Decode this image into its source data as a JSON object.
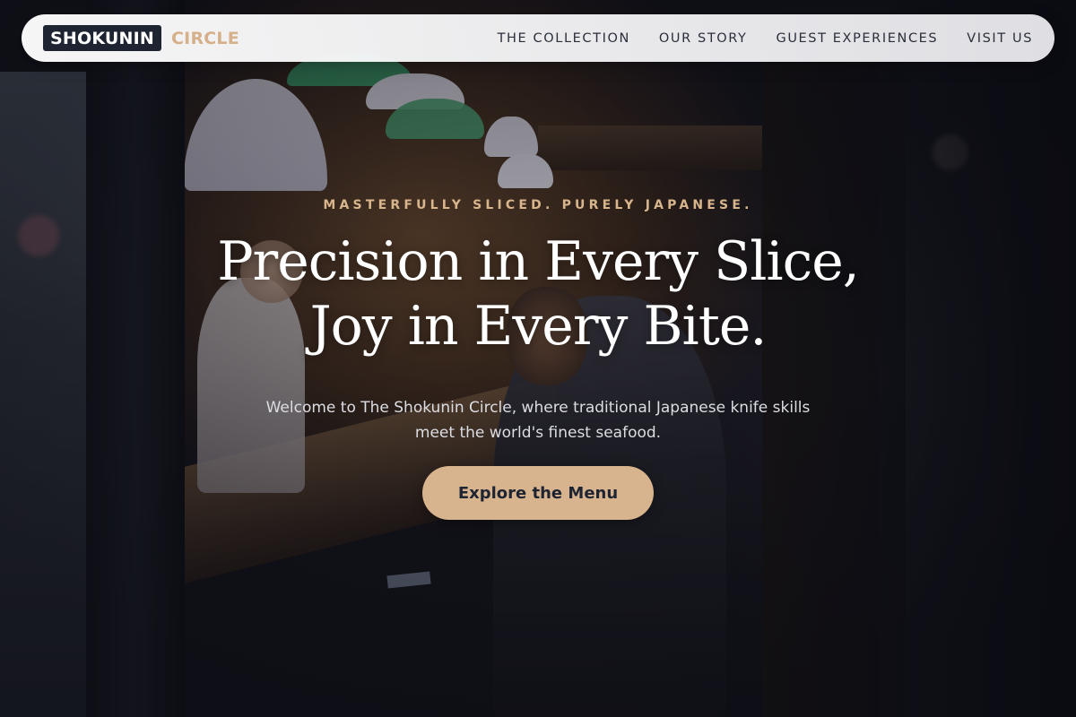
{
  "brand": {
    "name_main": "SHOKUNIN",
    "name_sub": "CIRCLE",
    "colors": {
      "dark": "#1f2433",
      "accent": "#d5b08a"
    }
  },
  "nav": {
    "items": [
      {
        "label": "THE COLLECTION"
      },
      {
        "label": "OUR STORY"
      },
      {
        "label": "GUEST EXPERIENCES"
      },
      {
        "label": "VISIT US"
      }
    ]
  },
  "hero": {
    "eyebrow": "MASTERFULLY SLICED. PURELY JAPANESE.",
    "title_line1": "Precision in Every Slice,",
    "title_line2": "Joy in Every Bite.",
    "subtitle": "Welcome to The Shokunin Circle, where traditional Japanese knife skills meet the world's finest seafood.",
    "cta_label": "Explore the Menu",
    "background": "izakaya-interior-photo"
  },
  "colors": {
    "cta_bg": "#d8b48e",
    "eyebrow": "#d9b58c",
    "title": "#ffffff"
  }
}
